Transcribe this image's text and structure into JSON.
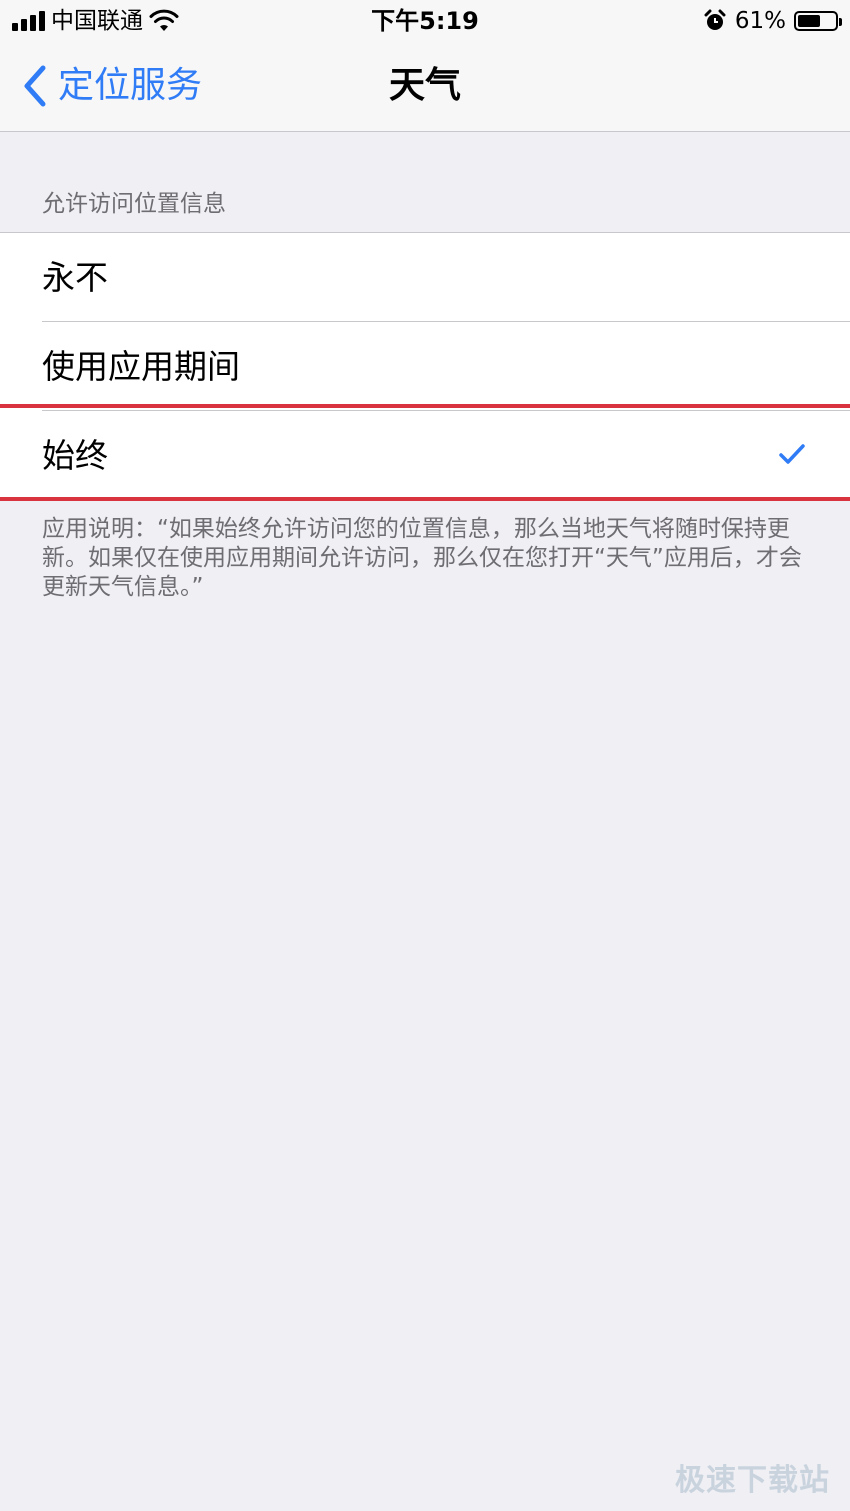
{
  "status_bar": {
    "carrier": "中国联通",
    "time": "下午5:19",
    "battery_percent": "61%",
    "battery_level": 0.61,
    "icons": [
      "signal-icon",
      "wifi-icon",
      "alarm-icon",
      "battery-icon"
    ]
  },
  "nav": {
    "back_label": "定位服务",
    "title": "天气"
  },
  "section": {
    "header": "允许访问位置信息"
  },
  "options": [
    {
      "label": "永不",
      "selected": false
    },
    {
      "label": "使用应用期间",
      "selected": false
    },
    {
      "label": "始终",
      "selected": true
    }
  ],
  "footer": {
    "description": "应用说明：“如果始终允许访问您的位置信息，那么当地天气将随时保持更新。如果仅在使用应用期间允许访问，那么仅在您打开“天气”应用后，才会更新天气信息。”"
  },
  "watermark": "极速下载站",
  "colors": {
    "accent": "#2f7cf6",
    "highlight": "#d9333f",
    "background": "#efeff4"
  }
}
